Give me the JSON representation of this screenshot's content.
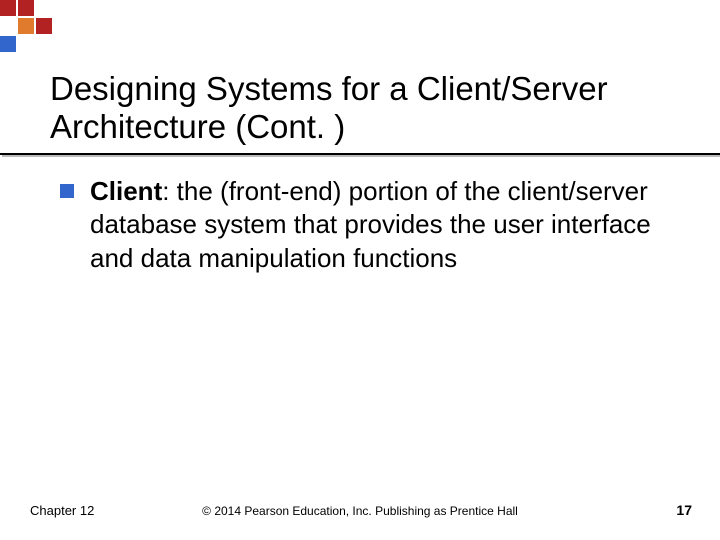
{
  "title": "Designing Systems for a Client/Server Architecture (Cont. )",
  "bullets": [
    {
      "term": "Client",
      "text": ": the (front-end) portion of the client/server database system that provides the user interface and data manipulation functions"
    }
  ],
  "footer": {
    "left": "Chapter 12",
    "center": "© 2014 Pearson Education, Inc. Publishing as Prentice Hall",
    "page": "17"
  },
  "logo_colors": {
    "red": "#b22222",
    "orange": "#e07b2e",
    "blue": "#3366cc"
  }
}
